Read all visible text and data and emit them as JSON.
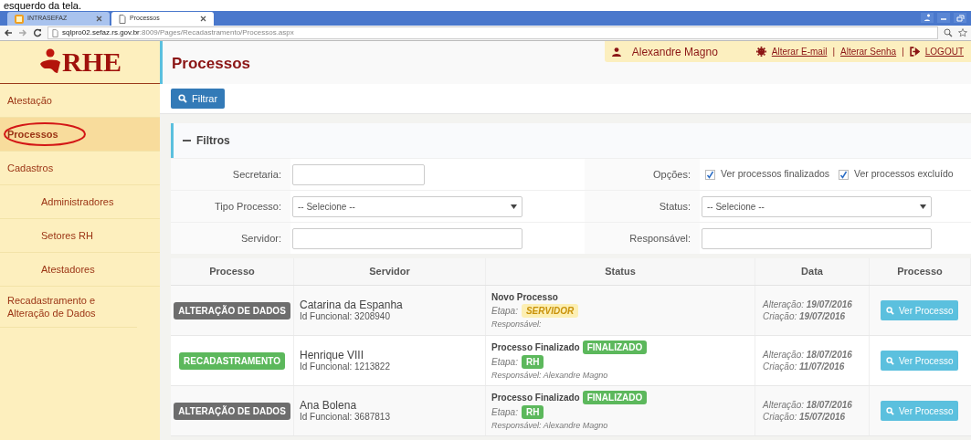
{
  "caption": "esquerdo da tela.",
  "browser": {
    "tabs": [
      {
        "title": "INTRASEFAZ",
        "selected": false
      },
      {
        "title": "Processos",
        "selected": true
      }
    ],
    "url_host": "sqlpro02.sefaz.rs.gov.br",
    "url_path": ":8009/Pages/Recadastramento/Processos.aspx"
  },
  "sidebar": {
    "logo": "RHE",
    "items": [
      {
        "label": "Atestação",
        "selected": false
      },
      {
        "label": "Processos",
        "selected": true,
        "annotated": true
      },
      {
        "label": "Cadastros",
        "selected": false,
        "children": [
          {
            "label": "Administradores",
            "selected": false
          },
          {
            "label": "Setores RH",
            "selected": false
          },
          {
            "label": "Atestadores",
            "selected": false
          }
        ]
      },
      {
        "label": "Recadastramento e Alteração de Dados",
        "selected": false
      }
    ]
  },
  "header": {
    "title": "Processos",
    "user": "Alexandre Magno",
    "links": [
      "Alterar E-mail",
      "Alterar Senha"
    ],
    "separator": "|",
    "logout": "LOGOUT"
  },
  "filter_button": "Filtrar",
  "filters": {
    "title": "Filtros",
    "expanded": true,
    "fields": [
      {
        "kind": "text",
        "label": "Secretaria:",
        "short": true
      },
      {
        "kind": "checks",
        "label": "Opções:",
        "options": [
          {
            "label": "Ver processos finalizados",
            "checked": true
          },
          {
            "label": "Ver processos excluído",
            "checked": true
          }
        ]
      },
      {
        "kind": "select",
        "label": "Tipo Processo:",
        "value": "-- Selecione --"
      },
      {
        "kind": "select",
        "label": "Status:",
        "value": "-- Selecione --"
      },
      {
        "kind": "text",
        "label": "Servidor:"
      },
      {
        "kind": "text",
        "label": "Responsável:"
      }
    ]
  },
  "table": {
    "columns": [
      "Processo",
      "Servidor",
      "Status",
      "Data",
      "Processo"
    ],
    "rows": [
      {
        "type": {
          "label": "ALTERAÇÃO DE DADOS",
          "color": "#6d6d6d"
        },
        "name": "Catarina da Espanha",
        "id": "Id Funcional: 3208940",
        "status": "Novo Processo",
        "status_badge": null,
        "stage_label": "Etapa:",
        "stage": {
          "label": "SERVIDOR",
          "color": "#fcefb4"
        },
        "responsible": "Responsável:",
        "altered": "Alteração: **19/07/2016**",
        "created": "Criação: **19/07/2016**",
        "action": "Ver Processo"
      },
      {
        "type": {
          "label": "RECADASTRAMENTO",
          "color": "#5cb85c"
        },
        "name": "Henrique VIII",
        "id": "Id Funcional: 1213822",
        "status": "Processo Finalizado",
        "status_badge": {
          "label": "FINALIZADO",
          "color": "#5cb85c"
        },
        "stage_label": "Etapa:",
        "stage": {
          "label": "RH",
          "color": "#5cb85c"
        },
        "responsible": "Responsável: Alexandre Magno",
        "altered": "Alteração: **18/07/2016**",
        "created": "Criação: **11/07/2016**",
        "action": "Ver Processo"
      },
      {
        "type": {
          "label": "ALTERAÇÃO DE DADOS",
          "color": "#6d6d6d"
        },
        "name": "Ana Bolena",
        "id": "Id Funcional: 3687813",
        "status": "Processo Finalizado",
        "status_badge": {
          "label": "FINALIZADO",
          "color": "#5cb85c"
        },
        "stage_label": "Etapa:",
        "stage": {
          "label": "RH",
          "color": "#5cb85c"
        },
        "responsible": "Responsável: Alexandre Magno",
        "altered": "Alteração: **18/07/2016**",
        "created": "Criação: **15/07/2016**",
        "action": "Ver Processo"
      }
    ]
  }
}
